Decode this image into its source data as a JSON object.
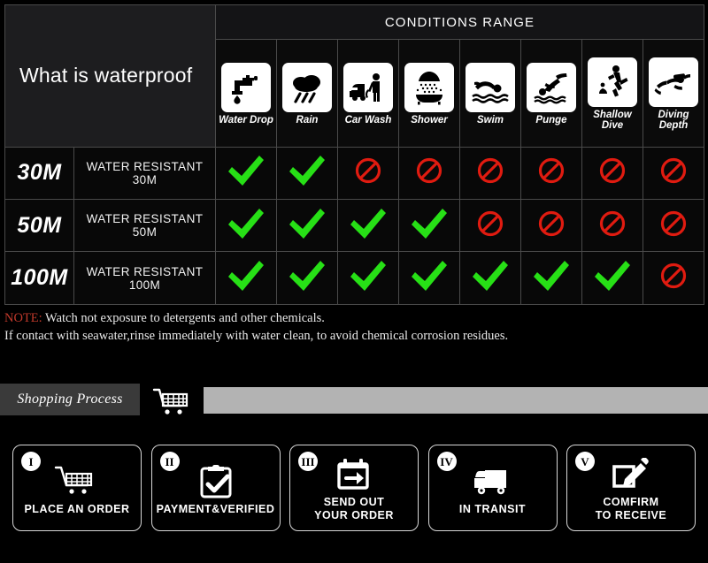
{
  "waterproof_table": {
    "title": "What is waterproof",
    "conditions_range_header": "CONDITIONS RANGE",
    "columns": [
      {
        "label": "Water Drop",
        "icon": "faucet-water-drop-icon"
      },
      {
        "label": "Rain",
        "icon": "rain-cloud-icon"
      },
      {
        "label": "Car Wash",
        "icon": "car-wash-icon"
      },
      {
        "label": "Shower",
        "icon": "shower-icon"
      },
      {
        "label": "Swim",
        "icon": "swimmer-icon"
      },
      {
        "label": "Punge",
        "icon": "plunge-dive-icon"
      },
      {
        "label": "Shallow Dive",
        "icon": "shallow-dive-icon"
      },
      {
        "label": "Diving Depth",
        "icon": "scuba-diver-icon"
      }
    ],
    "rows": [
      {
        "depth": "30M",
        "description": "WATER RESISTANT  30M",
        "marks": [
          "check",
          "check",
          "no",
          "no",
          "no",
          "no",
          "no",
          "no"
        ]
      },
      {
        "depth": "50M",
        "description": "WATER RESISTANT 50M",
        "marks": [
          "check",
          "check",
          "check",
          "check",
          "no",
          "no",
          "no",
          "no"
        ]
      },
      {
        "depth": "100M",
        "description": "WATER RESISTANT  100M",
        "marks": [
          "check",
          "check",
          "check",
          "check",
          "check",
          "check",
          "check",
          "no"
        ]
      }
    ],
    "colors": {
      "check": "#27e016",
      "no": "#e01b10",
      "grid": "#4a4a4a",
      "title_bg": "#1d1d1f"
    }
  },
  "note": {
    "label": "NOTE:",
    "line1": " Watch not exposure to detergents and other chemicals.",
    "line2": "If contact with seawater,rinse immediately with water clean, to avoid chemical corrosion residues.",
    "label_color": "#c0392b"
  },
  "shopping_bar": {
    "tag_label": "Shopping Process",
    "cart_icon": "shopping-cart-icon",
    "tag_bg": "#3a3a3a",
    "bar_color": "#b3b3b3"
  },
  "steps": [
    {
      "numeral": "I",
      "label": "PLACE AN ORDER",
      "icon": "shopping-cart-icon"
    },
    {
      "numeral": "II",
      "label": "PAYMENT&VERIFIED",
      "icon": "clipboard-check-icon"
    },
    {
      "numeral": "III",
      "label": "SEND OUT\nYOUR ORDER",
      "icon": "package-arrow-icon"
    },
    {
      "numeral": "IV",
      "label": "IN TRANSIT",
      "icon": "delivery-truck-icon"
    },
    {
      "numeral": "V",
      "label": "COMFIRM\nTO RECEIVE",
      "icon": "edit-pencil-icon"
    }
  ]
}
